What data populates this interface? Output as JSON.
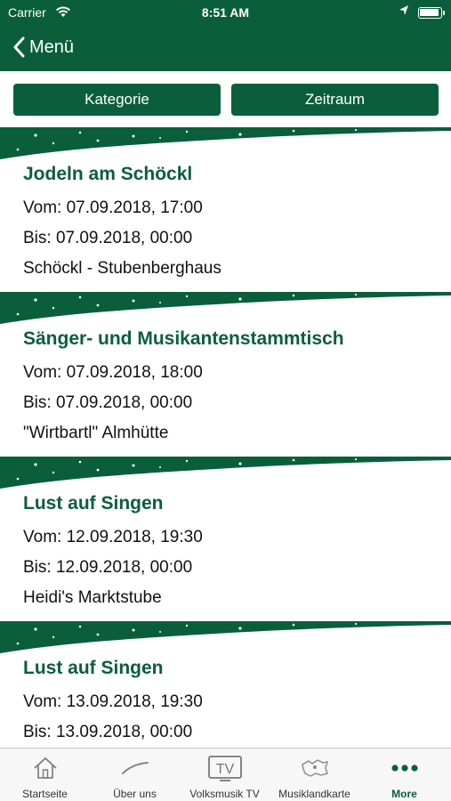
{
  "status_bar": {
    "carrier": "Carrier",
    "time": "8:51 AM"
  },
  "nav": {
    "back_label": "Menü"
  },
  "filters": {
    "category": "Kategorie",
    "period": "Zeitraum"
  },
  "events": [
    {
      "title": "Jodeln am Schöckl",
      "from": "Vom: 07.09.2018, 17:00",
      "to": "Bis: 07.09.2018, 00:00",
      "location": "Schöckl - Stubenberghaus"
    },
    {
      "title": "Sänger- und Musikantenstammtisch",
      "from": "Vom: 07.09.2018, 18:00",
      "to": "Bis: 07.09.2018, 00:00",
      "location": "\"Wirtbartl\" Almhütte"
    },
    {
      "title": "Lust auf Singen",
      "from": "Vom: 12.09.2018, 19:30",
      "to": "Bis: 12.09.2018, 00:00",
      "location": "Heidi's Marktstube"
    },
    {
      "title": "Lust auf Singen",
      "from": "Vom: 13.09.2018, 19:30",
      "to": "Bis: 13.09.2018, 00:00",
      "location": ""
    }
  ],
  "tabbar": {
    "tabs": [
      {
        "label": "Startseite",
        "icon": "home-icon"
      },
      {
        "label": "Über uns",
        "icon": "hat-icon"
      },
      {
        "label": "Volksmusik TV",
        "icon": "tv-icon"
      },
      {
        "label": "Musiklandkarte",
        "icon": "map-icon"
      },
      {
        "label": "More",
        "icon": "more-icon"
      }
    ]
  },
  "colors": {
    "brand_green": "#0b5e3b",
    "tabbar_bg": "#f7f7f7",
    "text": "#111111"
  }
}
